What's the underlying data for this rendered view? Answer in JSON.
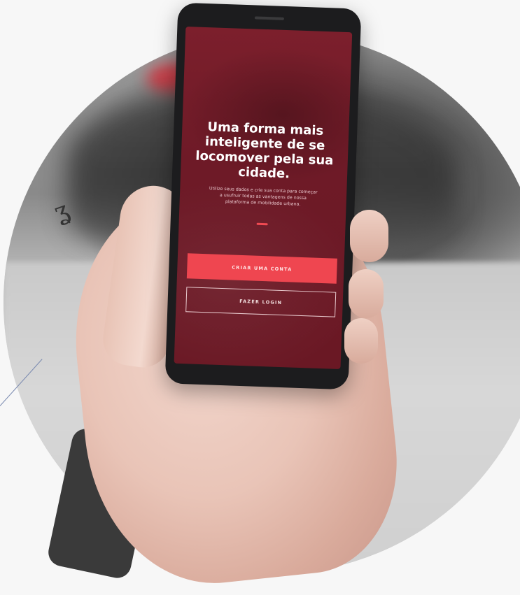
{
  "screen": {
    "title": "Uma forma mais inteligente de se locomover pela sua cidade.",
    "subtitle": "Utilize seus dados e crie sua conta para começar a usufruir todas as vantagens de nossa plataforma de mobilidade urbana.",
    "create_account_label": "CRIAR UMA CONTA",
    "login_label": "FAZER LOGIN"
  },
  "colors": {
    "screen_background": "#6e1a27",
    "primary_button": "#ef4650",
    "accent_divider": "#f14a52"
  },
  "icons": {
    "divider": "accent-bar"
  }
}
